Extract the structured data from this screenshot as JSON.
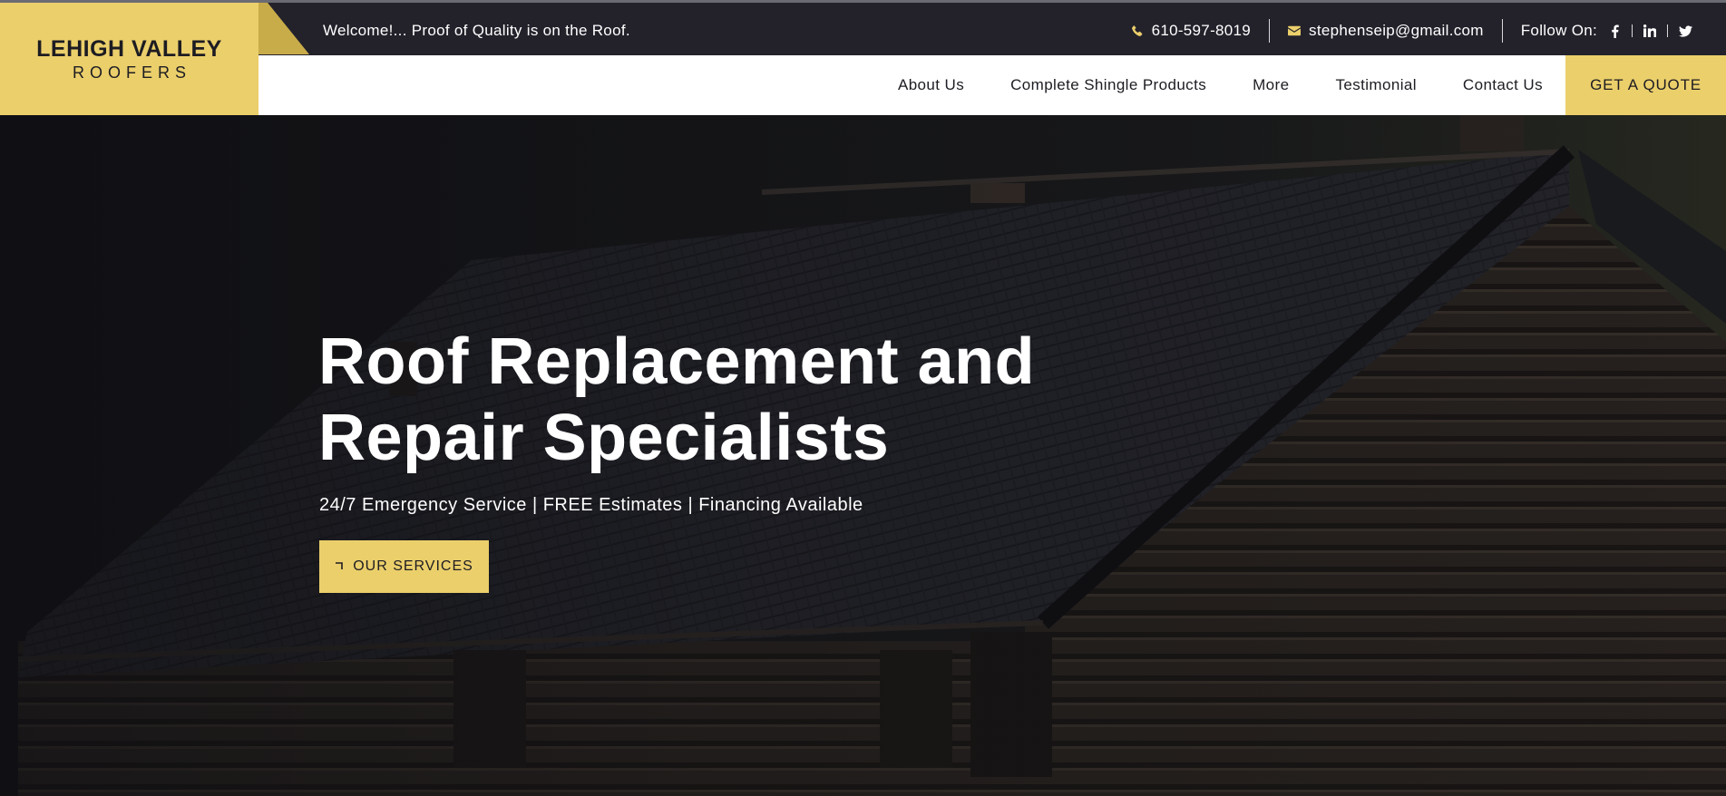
{
  "logo": {
    "main": "LEHIGH VALLEY",
    "sub": "ROOFERS"
  },
  "topbar": {
    "welcome": "Welcome!... Proof of Quality is on the Roof.",
    "phone": "610-597-8019",
    "email": "stephenseip@gmail.com",
    "follow_label": "Follow On:",
    "phone_icon": "phone-icon",
    "email_icon": "envelope-icon",
    "socials": [
      "facebook-icon",
      "linkedin-icon",
      "twitter-icon"
    ]
  },
  "nav": {
    "items": [
      {
        "label": "About Us"
      },
      {
        "label": "Complete Shingle Products"
      },
      {
        "label": "More"
      },
      {
        "label": "Testimonial"
      },
      {
        "label": "Contact Us"
      }
    ],
    "cta": "GET A QUOTE"
  },
  "hero": {
    "title_line1": "Roof Replacement and",
    "title_line2": "Repair Specialists",
    "subtitle": "24/7 Emergency Service | FREE Estimates | Financing Available",
    "button_label": "OUR SERVICES",
    "button_icon": "corner-arrow-icon"
  },
  "colors": {
    "accent": "#ebcf6b",
    "topbar_bg": "#23222b",
    "nav_bg": "#ffffff",
    "text_dark": "#1d1c22"
  }
}
